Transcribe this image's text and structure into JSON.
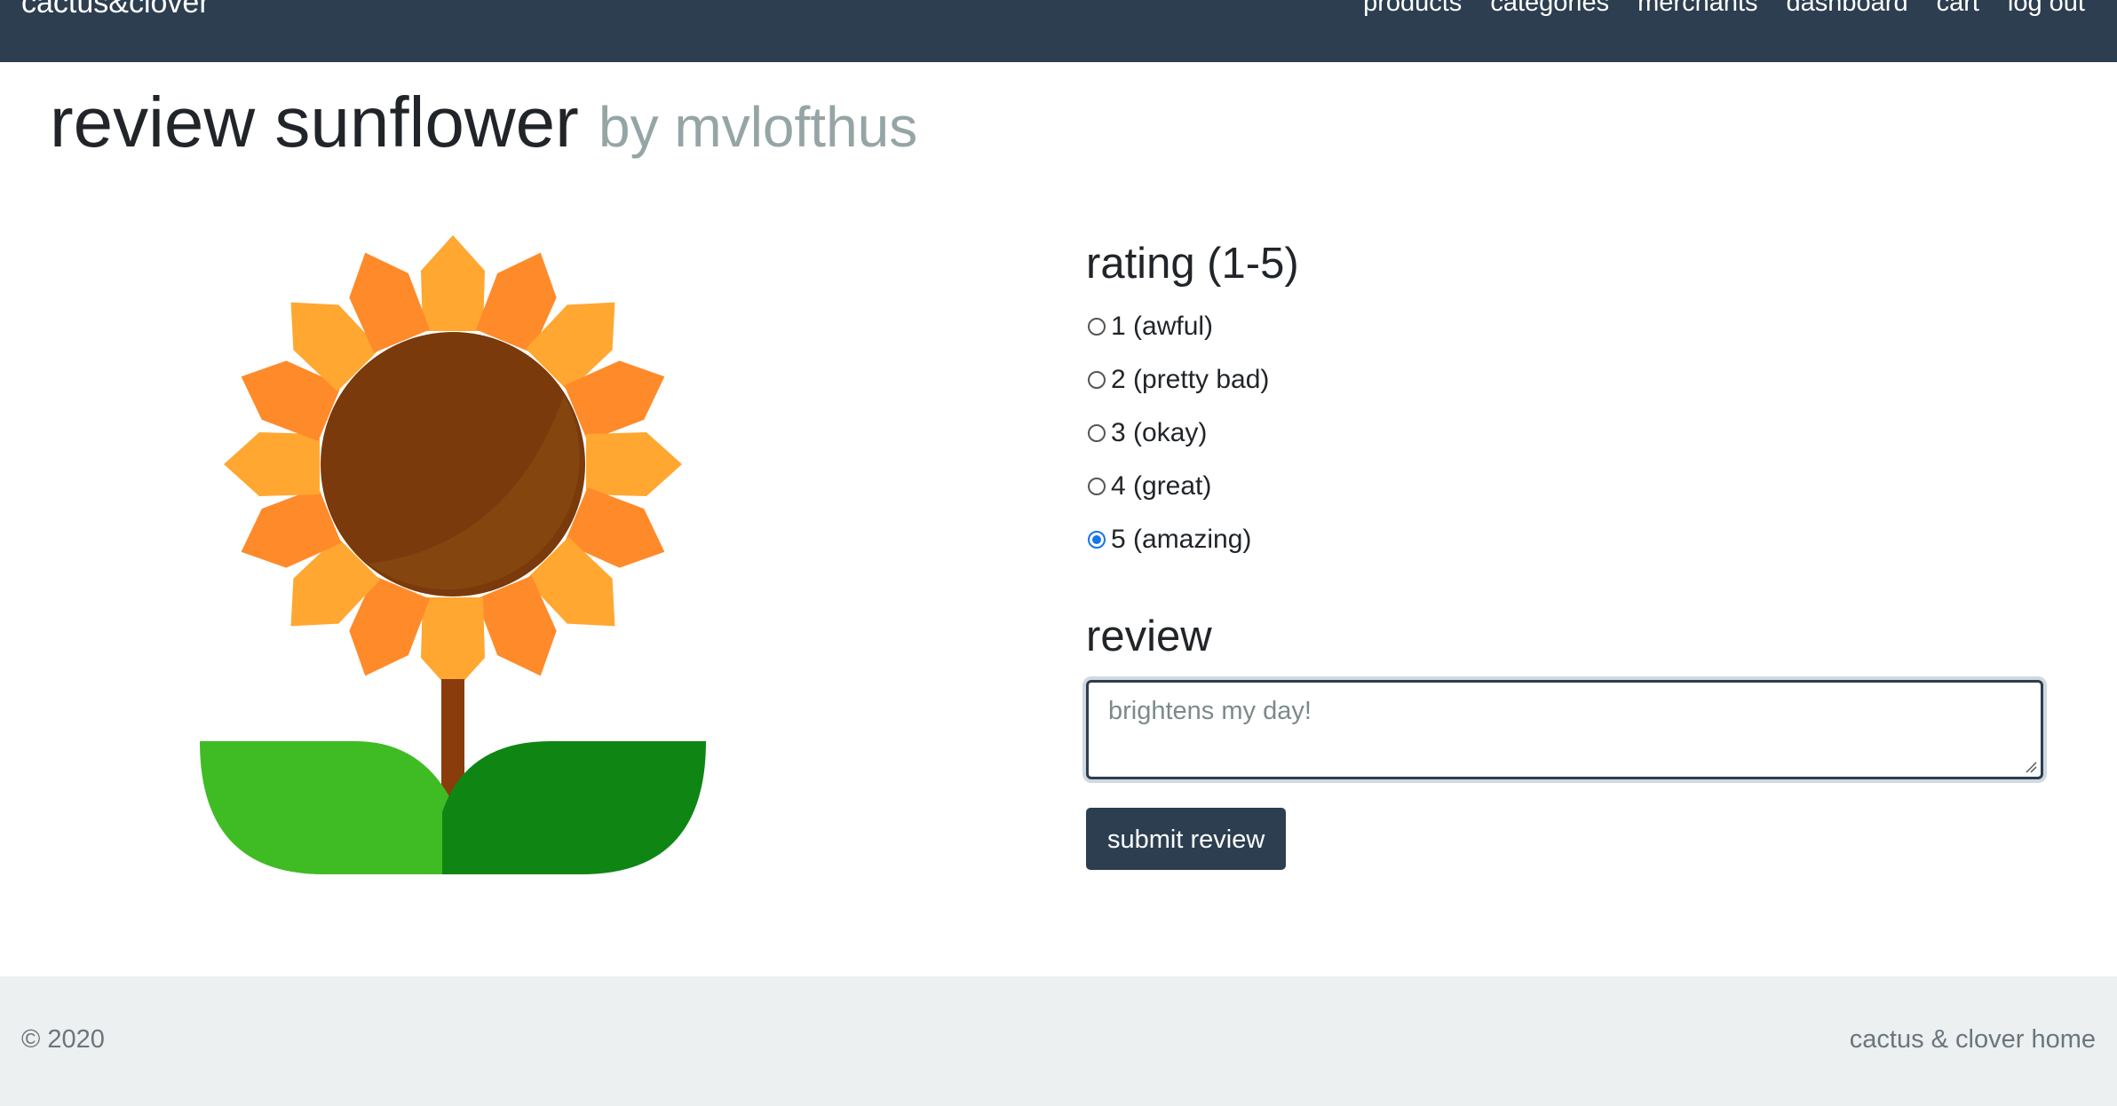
{
  "navbar": {
    "brand": "cactus&clover",
    "links": [
      "products",
      "categories",
      "merchants",
      "dashboard",
      "cart",
      "log out"
    ]
  },
  "page": {
    "title": "review sunflower",
    "subtitle": "by mvlofthus"
  },
  "product_image": {
    "icon": "sunflower-illustration",
    "colors": {
      "petal_light": "#ffa730",
      "petal_dark": "#ff8a2a",
      "center": "#7a3a0c",
      "stem": "#8a3c0c",
      "leaf_left": "#3fbc24",
      "leaf_right": "#0f8614"
    }
  },
  "form": {
    "rating_heading": "rating (1-5)",
    "rating_options": [
      {
        "value": "1",
        "label": "1 (awful)",
        "checked": false
      },
      {
        "value": "2",
        "label": "2 (pretty bad)",
        "checked": false
      },
      {
        "value": "3",
        "label": "3 (okay)",
        "checked": false
      },
      {
        "value": "4",
        "label": "4 (great)",
        "checked": false
      },
      {
        "value": "5",
        "label": "5 (amazing)",
        "checked": true
      }
    ],
    "review_heading": "review",
    "review_text": "brightens my day!",
    "submit_label": "submit review"
  },
  "footer": {
    "copyright": "© 2020",
    "home_link": "cactus & clover home"
  },
  "colors": {
    "navbar_bg": "#2c3e50",
    "footer_bg": "#ecf0f1",
    "accent": "#1a73e8",
    "muted": "#95a5a6"
  }
}
